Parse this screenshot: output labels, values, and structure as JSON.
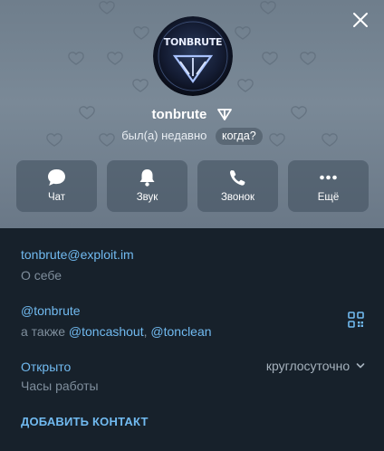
{
  "profile": {
    "name": "tonbrute",
    "status": "был(а) недавно",
    "when_label": "когда?",
    "avatar_text": "TONBRUTE"
  },
  "actions": [
    {
      "label": "Чат",
      "icon": "chat-bubble-icon"
    },
    {
      "label": "Звук",
      "icon": "bell-icon"
    },
    {
      "label": "Звонок",
      "icon": "phone-icon"
    },
    {
      "label": "Ещё",
      "icon": "more-icon"
    }
  ],
  "info": {
    "email": "tonbrute@exploit.im",
    "about_label": "О себе",
    "username": "@tonbrute",
    "also_prefix": "а также ",
    "also_usernames": [
      "@toncashout",
      "@tonclean"
    ],
    "also_separator": ", ",
    "open_status": "Открыто",
    "hours_label": "Часы работы",
    "hours_value": "круглосуточно",
    "add_contact": "ДОБАВИТЬ КОНТАКТ"
  },
  "colors": {
    "background": "#17212b",
    "header": "#7a8997",
    "accent": "#71baf0",
    "muted": "#7f8e9c"
  }
}
